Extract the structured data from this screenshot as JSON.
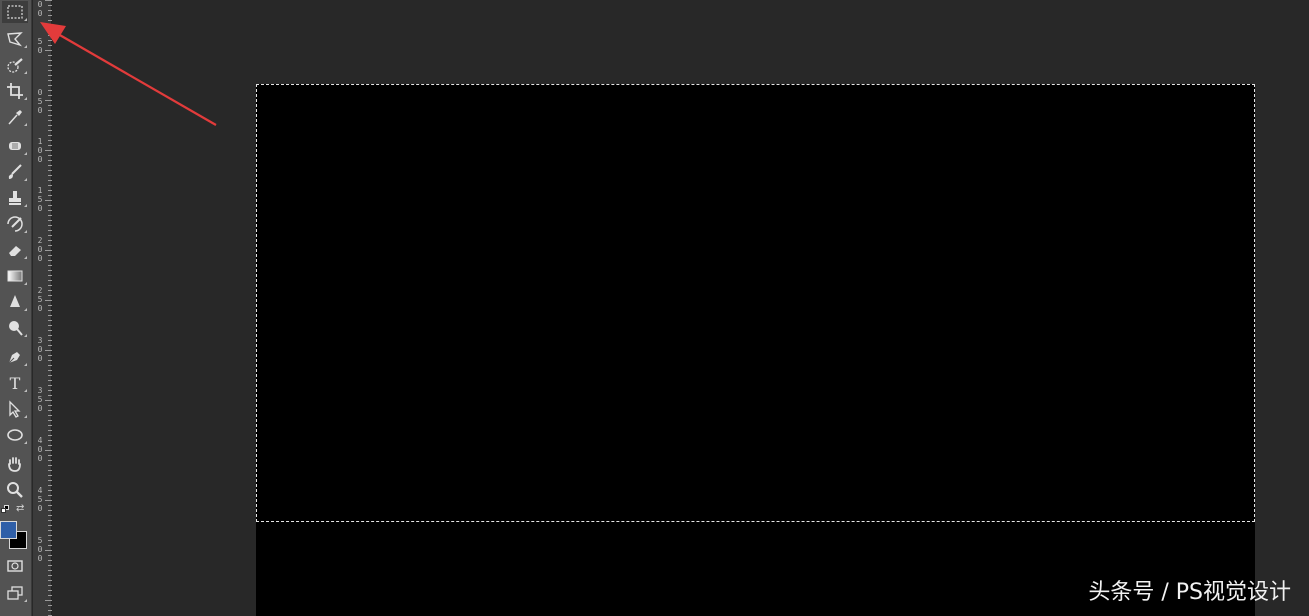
{
  "toolbar": {
    "tools": [
      {
        "name": "rectangular-marquee-icon",
        "active": true
      },
      {
        "name": "lasso-icon"
      },
      {
        "name": "quick-selection-icon"
      },
      {
        "name": "crop-icon"
      },
      {
        "name": "eyedropper-icon"
      },
      {
        "name": "spot-healing-icon"
      },
      {
        "name": "brush-icon"
      },
      {
        "name": "clone-stamp-icon"
      },
      {
        "name": "history-brush-icon"
      },
      {
        "name": "eraser-icon"
      },
      {
        "name": "gradient-icon"
      },
      {
        "name": "blur-icon"
      },
      {
        "name": "dodge-icon"
      },
      {
        "name": "pen-icon"
      },
      {
        "name": "type-icon",
        "label": "T"
      },
      {
        "name": "path-selection-icon"
      },
      {
        "name": "ellipse-icon"
      },
      {
        "name": "hand-icon"
      },
      {
        "name": "zoom-icon"
      }
    ],
    "foreground_color": "#2f5fa8",
    "background_color": "#000000"
  },
  "ruler": {
    "labels": [
      "0",
      "0",
      "5",
      "0",
      "0",
      "5",
      "0",
      "1",
      "0",
      "0",
      "1",
      "5",
      "0",
      "2",
      "0",
      "0",
      "2",
      "5",
      "0",
      "3",
      "0",
      "0",
      "3",
      "5",
      "0",
      "4",
      "0",
      "0",
      "4",
      "5",
      "0",
      "5",
      "0",
      "0"
    ]
  },
  "canvas": {
    "document_color": "#000000",
    "selection_style": "marching-ants"
  },
  "annotation": {
    "arrow_color": "#e23b3b"
  },
  "watermark": {
    "text": "头条号 / PS视觉设计"
  }
}
